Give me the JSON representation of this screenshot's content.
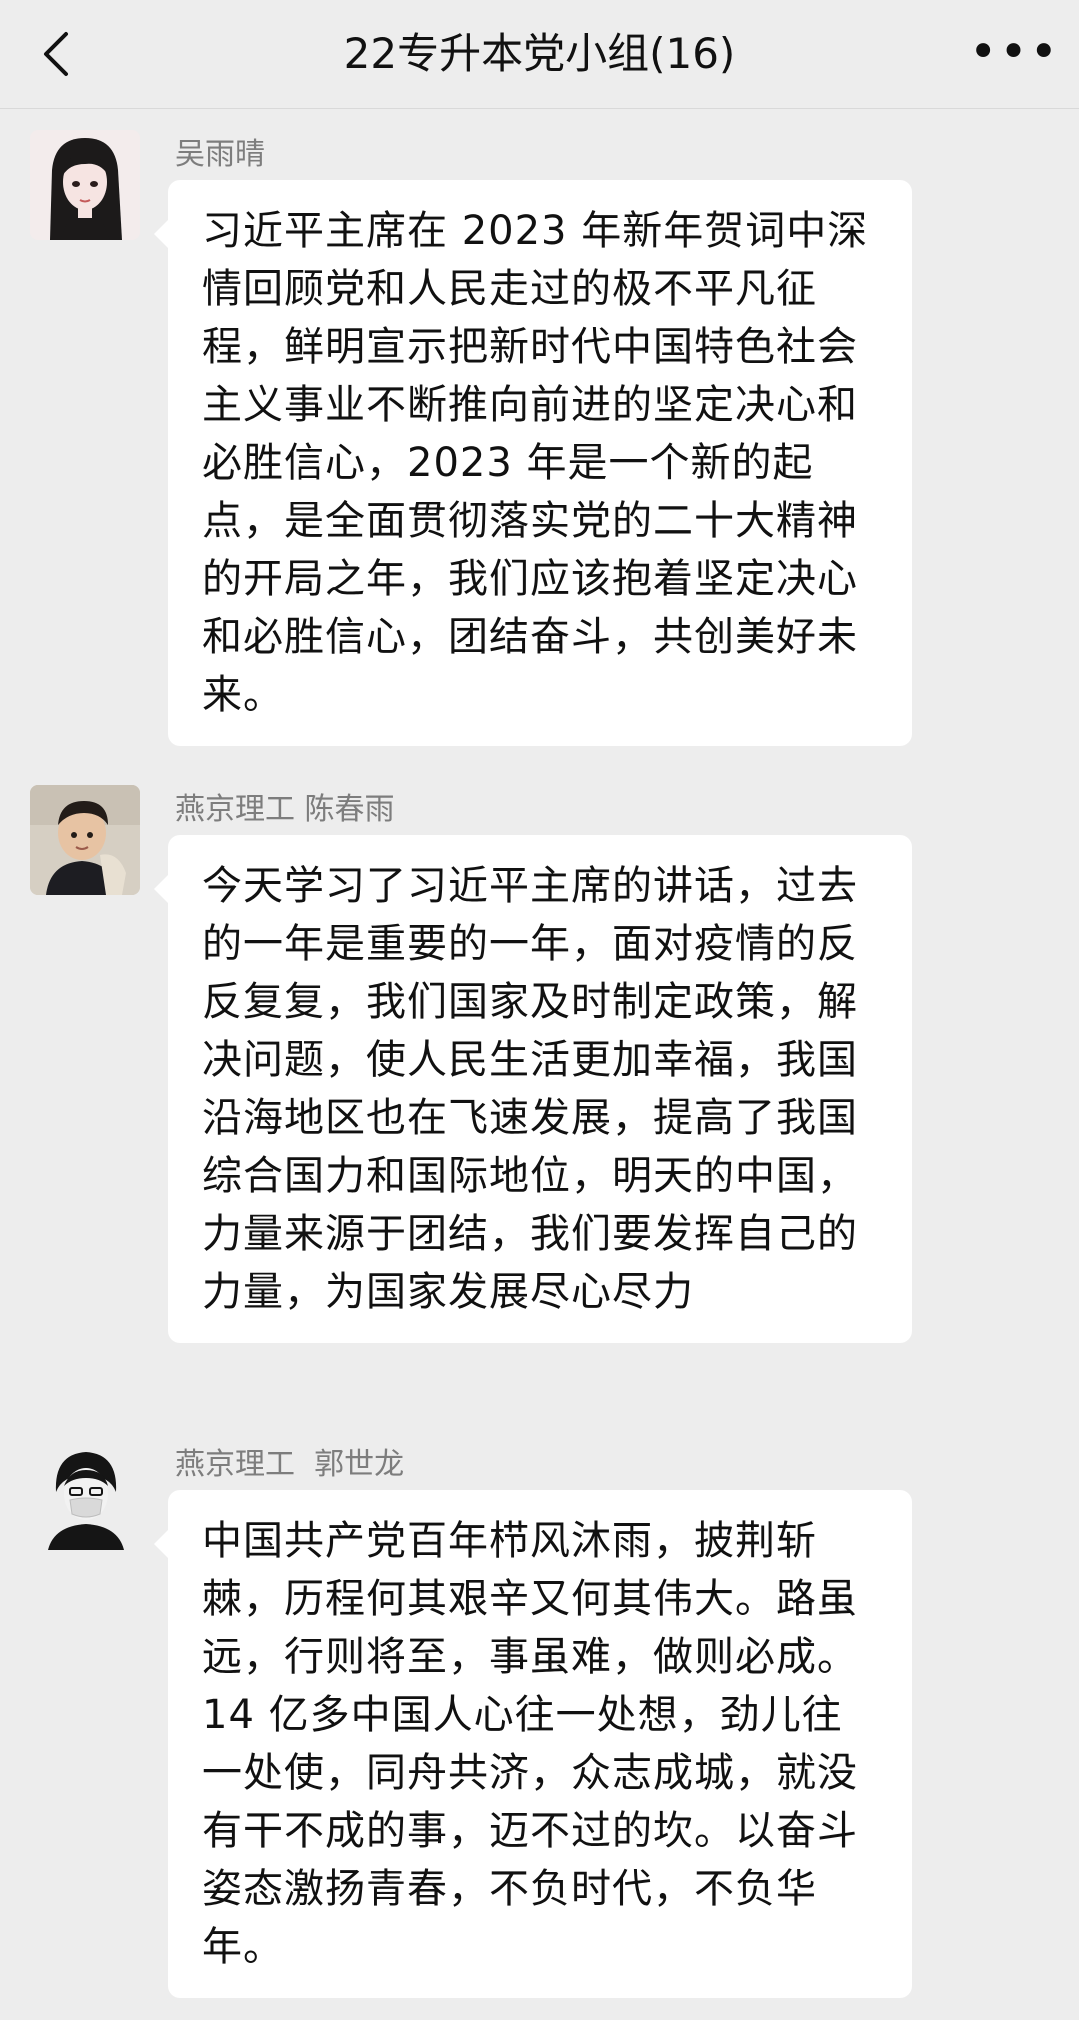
{
  "header": {
    "title": "22专升本党小组(16)",
    "back_icon": "chevron-left-icon",
    "more_icon": "more-horizontal-icon",
    "more_label": "•••"
  },
  "messages": [
    {
      "sender": "吴雨晴",
      "avatar": "avatar-girl-illustration",
      "text": "习近平主席在 2023 年新年贺词中深情回顾党和人民走过的极不平凡征程，鲜明宣示把新时代中国特色社会主义事业不断推向前进的坚定决心和必胜信心，2023 年是一个新的起点，是全面贯彻落实党的二十大精神的开局之年，我们应该抱着坚定决心和必胜信心，团结奋斗，共创美好未来。"
    },
    {
      "sender": "燕京理工 陈春雨",
      "avatar": "avatar-boy-photo",
      "text": "今天学习了习近平主席的讲话，过去的一年是重要的一年，面对疫情的反反复复，我们国家及时制定政策，解决问题，使人民生活更加幸福，我国沿海地区也在飞速发展，提高了我国综合国力和国际地位，明天的中国，力量来源于团结，我们要发挥自己的力量，为国家发展尽心尽力"
    },
    {
      "sender": "燕京理工  郭世龙",
      "avatar": "avatar-masked-illustration",
      "text": "中国共产党百年栉风沐雨，披荆斩棘，历程何其艰辛又何其伟大。路虽远，行则将至，事虽难，做则必成。14 亿多中国人心往一处想，劲儿往一处使，同舟共济，众志成城，就没有干不成的事，迈不过的坎。以奋斗姿态激扬青春，不负时代，不负华年。"
    }
  ],
  "colors": {
    "background": "#ededed",
    "bubble": "#ffffff",
    "sender_name": "#7d7d7d",
    "text": "#111111"
  }
}
